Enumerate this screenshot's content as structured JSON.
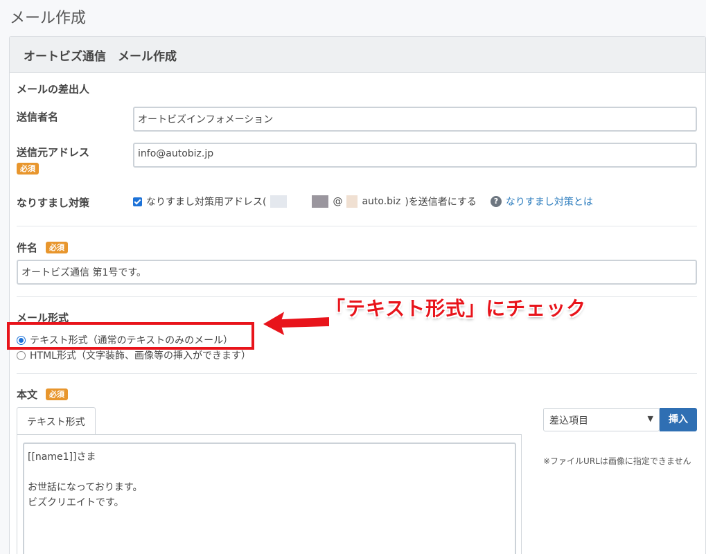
{
  "page_title": "メール作成",
  "panel_title": "オートビズ通信　メール作成",
  "sender_section": "メールの差出人",
  "sender_name": {
    "label": "送信者名",
    "value": "オートビズインフォメーション"
  },
  "sender_address": {
    "label": "送信元アドレス",
    "required": "必須",
    "value": "info@autobiz.jp"
  },
  "spoofing": {
    "label": "なりすまし対策",
    "checkbox_text_prefix": "なりすまし対策用アドレス(",
    "checkbox_text_at": "@",
    "checkbox_text_domain": "auto.biz",
    "checkbox_text_suffix": ")を送信者にする",
    "help_link": "なりすまし対策とは",
    "help_icon": "?"
  },
  "subject": {
    "label": "件名",
    "required": "必須",
    "value": "オートビズ通信 第1号です。"
  },
  "mail_format": {
    "label": "メール形式",
    "options": [
      "テキスト形式（通常のテキストのみのメール）",
      "HTML形式（文字装飾、画像等の挿入ができます）"
    ],
    "selected": 0
  },
  "body": {
    "label": "本文",
    "required": "必須",
    "tab": "テキスト形式",
    "content": "[[name1]]さま\n\nお世話になっております。\nビズクリエイトです。",
    "merge_select": "差込項目",
    "insert_button": "挿入",
    "note": "※ファイルURLは画像に指定できません"
  },
  "annotation": {
    "callout": "「テキスト形式」にチェック"
  },
  "colors": {
    "accent": "#2f6fb3",
    "required_badge": "#e8962d",
    "annotation": "#e8141b"
  }
}
